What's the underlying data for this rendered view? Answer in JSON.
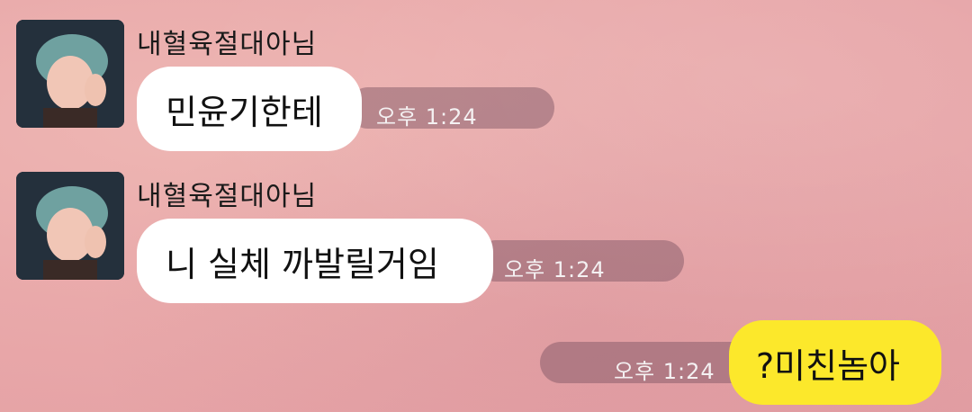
{
  "messages": [
    {
      "sender": "내혈육절대아님",
      "text": "민윤기한테",
      "time": "오후 1:24"
    },
    {
      "sender": "내혈육절대아님",
      "text": "니 실체 까발릴거임",
      "time": "오후 1:24"
    },
    {
      "text": "?미친놈아",
      "time": "오후 1:24"
    }
  ],
  "colors": {
    "incoming_bubble": "#ffffff",
    "outgoing_bubble": "#fce82b",
    "background": "#e9a9aa"
  }
}
